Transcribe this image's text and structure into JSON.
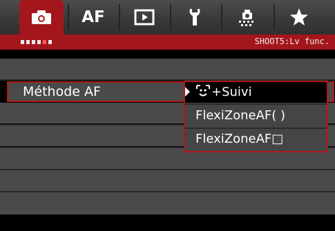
{
  "tabs": [
    {
      "id": "shooting",
      "label": "",
      "icon": "camera-icon",
      "active": true
    },
    {
      "id": "af",
      "label": "AF",
      "icon": "",
      "active": false
    },
    {
      "id": "playback",
      "label": "",
      "icon": "playback-icon",
      "active": false
    },
    {
      "id": "setup",
      "label": "",
      "icon": "wrench-icon",
      "active": false
    },
    {
      "id": "custom",
      "label": "",
      "icon": "custom-functions-icon",
      "active": false
    },
    {
      "id": "mymenu",
      "label": "",
      "icon": "star-icon",
      "active": false
    }
  ],
  "page_indicator": {
    "total": 6,
    "current": 5
  },
  "page_title": "SHOOT5:Lv func.",
  "setting": {
    "label": "Méthode AF"
  },
  "dropdown": {
    "options": [
      {
        "label": "+Suivi",
        "icon": "face-tracking-icon",
        "selected": true
      },
      {
        "label": "FlexiZoneAF( )",
        "selected": false
      },
      {
        "label": "FlexiZoneAF□",
        "selected": false
      }
    ]
  },
  "colors": {
    "accent": "#a3161b",
    "row": "#4a4a4a",
    "background": "#000000",
    "text": "#ffffff"
  }
}
